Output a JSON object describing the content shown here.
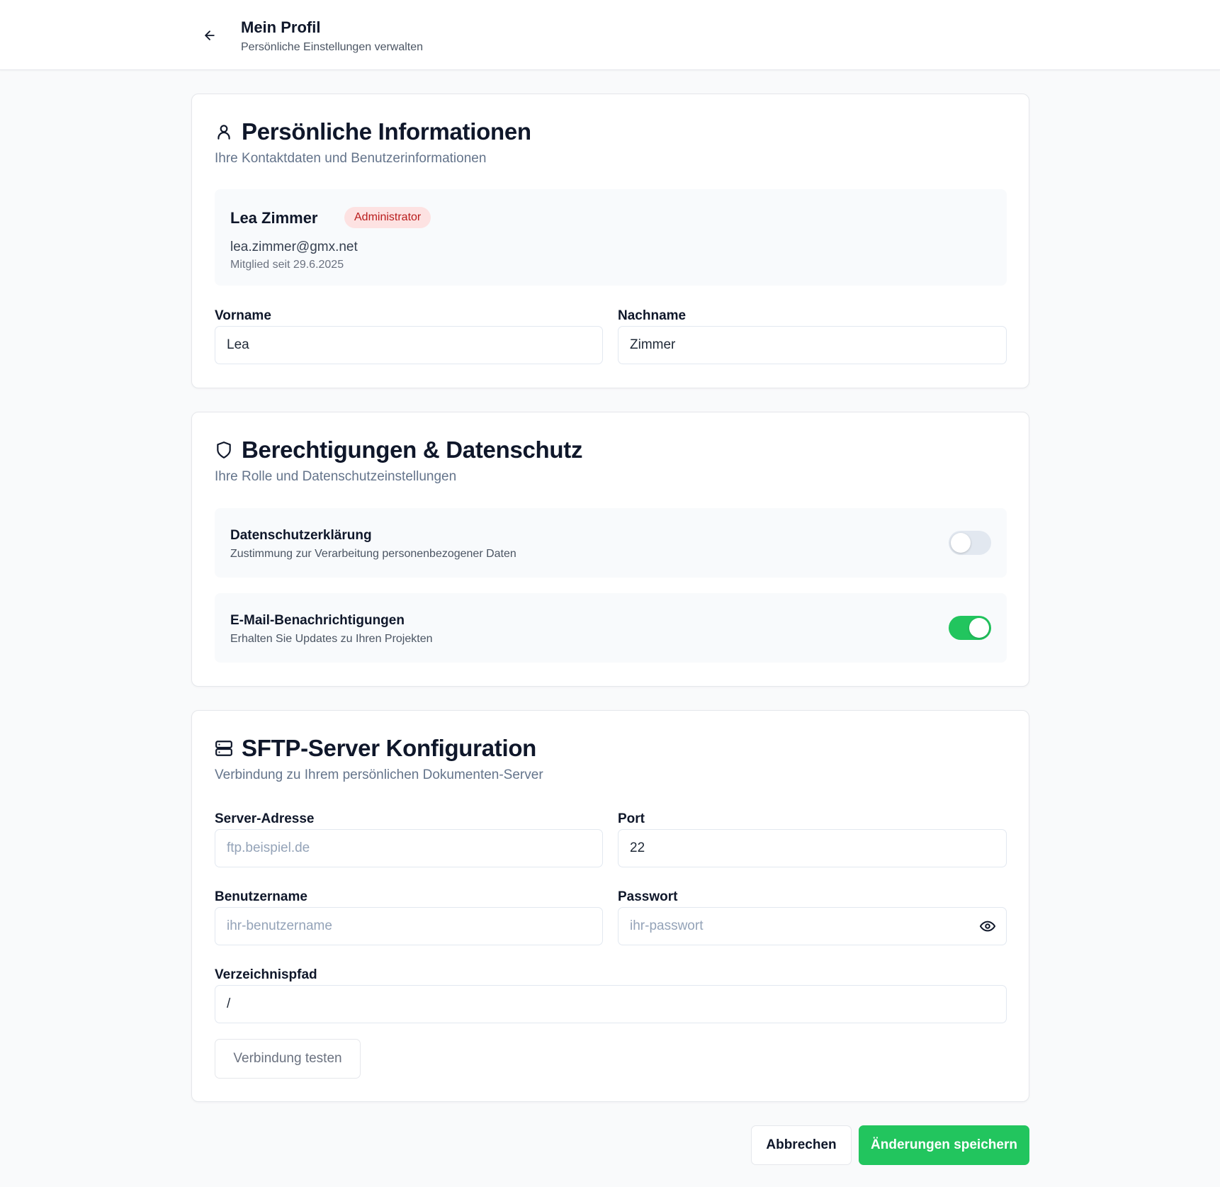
{
  "header": {
    "title": "Mein Profil",
    "subtitle": "Persönliche Einstellungen verwalten"
  },
  "personal": {
    "title": "Persönliche Informationen",
    "description": "Ihre Kontaktdaten und Benutzerinformationen",
    "name": "Lea Zimmer",
    "role_badge": "Administrator",
    "email": "lea.zimmer@gmx.net",
    "member_since": "Mitglied seit 29.6.2025",
    "first_name_label": "Vorname",
    "first_name_value": "Lea",
    "last_name_label": "Nachname",
    "last_name_value": "Zimmer"
  },
  "permissions": {
    "title": "Berechtigungen & Datenschutz",
    "description": "Ihre Rolle und Datenschutzeinstellungen",
    "privacy_title": "Datenschutzerklärung",
    "privacy_desc": "Zustimmung zur Verarbeitung personenbezogener Daten",
    "privacy_enabled": false,
    "email_title": "E-Mail-Benachrichtigungen",
    "email_desc": "Erhalten Sie Updates zu Ihren Projekten",
    "email_enabled": true
  },
  "sftp": {
    "title": "SFTP-Server Konfiguration",
    "description": "Verbindung zu Ihrem persönlichen Dokumenten-Server",
    "server_label": "Server-Adresse",
    "server_placeholder": "ftp.beispiel.de",
    "port_label": "Port",
    "port_value": "22",
    "username_label": "Benutzername",
    "username_placeholder": "ihr-benutzername",
    "password_label": "Passwort",
    "password_placeholder": "ihr-passwort",
    "path_label": "Verzeichnispfad",
    "path_value": "/",
    "test_button": "Verbindung testen"
  },
  "footer": {
    "cancel_label": "Abbrechen",
    "save_label": "Änderungen speichern"
  },
  "colors": {
    "accent": "#22c55e",
    "badge_bg": "#fde2e2",
    "badge_text": "#b91c1c"
  },
  "icons": {
    "back": "arrow-left-icon",
    "personal": "user-icon",
    "permissions": "shield-icon",
    "sftp": "server-icon",
    "password_toggle": "eye-icon"
  }
}
